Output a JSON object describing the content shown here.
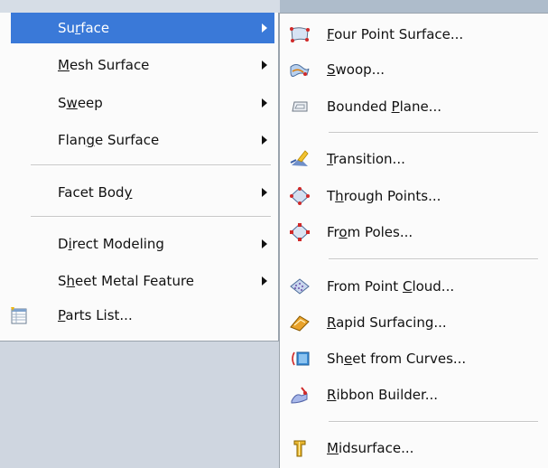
{
  "left_menu": {
    "items": [
      {
        "label": "Surface",
        "text": [
          "Su",
          "r",
          "face"
        ],
        "highlighted": true,
        "submenu": true
      },
      {
        "label": "Mesh Surface",
        "text": [
          "",
          "M",
          "esh Surface"
        ],
        "submenu": true
      },
      {
        "label": "Sweep",
        "text": [
          "S",
          "w",
          "eep"
        ],
        "submenu": true
      },
      {
        "label": "Flange Surface",
        "text": [
          "Flan",
          "g",
          "e Surface"
        ],
        "submenu": true
      },
      {
        "label": "Facet Body",
        "text": [
          "Facet Bod",
          "y",
          ""
        ],
        "submenu": true
      },
      {
        "label": "Direct Modeling",
        "text": [
          "D",
          "i",
          "rect Modeling"
        ],
        "submenu": true
      },
      {
        "label": "Sheet Metal Feature",
        "text": [
          "S",
          "h",
          "eet Metal Feature"
        ],
        "submenu": true
      },
      {
        "label": "Parts List...",
        "text": [
          "",
          "P",
          "arts List..."
        ],
        "icon": "parts-list-icon"
      }
    ]
  },
  "right_menu": {
    "items": [
      {
        "label": "Four Point Surface...",
        "text": [
          "",
          "F",
          "our Point Surface..."
        ],
        "icon": "four-point-surface-icon"
      },
      {
        "label": "Swoop...",
        "text": [
          "",
          "S",
          "woop..."
        ],
        "icon": "swoop-icon"
      },
      {
        "label": "Bounded Plane...",
        "text": [
          "Bounded ",
          "P",
          "lane..."
        ],
        "icon": "bounded-plane-icon"
      },
      {
        "label": "Transition...",
        "text": [
          "",
          "T",
          "ransition..."
        ],
        "icon": "transition-icon"
      },
      {
        "label": "Through Points...",
        "text": [
          "T",
          "h",
          "rough Points..."
        ],
        "icon": "through-points-icon"
      },
      {
        "label": "From Poles...",
        "text": [
          "Fr",
          "o",
          "m Poles..."
        ],
        "icon": "from-poles-icon"
      },
      {
        "label": "From Point Cloud...",
        "text": [
          "From Point ",
          "C",
          "loud..."
        ],
        "icon": "from-point-cloud-icon"
      },
      {
        "label": "Rapid Surfacing...",
        "text": [
          "",
          "R",
          "apid Surfacing..."
        ],
        "icon": "rapid-surfacing-icon"
      },
      {
        "label": "Sheet from Curves...",
        "text": [
          "Sh",
          "e",
          "et from Curves..."
        ],
        "icon": "sheet-from-curves-icon"
      },
      {
        "label": "Ribbon Builder...",
        "text": [
          "",
          "R",
          "ibbon Builder..."
        ],
        "icon": "ribbon-builder-icon"
      },
      {
        "label": "Midsurface...",
        "text": [
          "",
          "M",
          "idsurface..."
        ],
        "icon": "midsurface-icon"
      }
    ]
  },
  "colors": {
    "highlight": "#3a79d8",
    "menu_background": "#fbfbfb",
    "desktop": "#d6dde6"
  }
}
